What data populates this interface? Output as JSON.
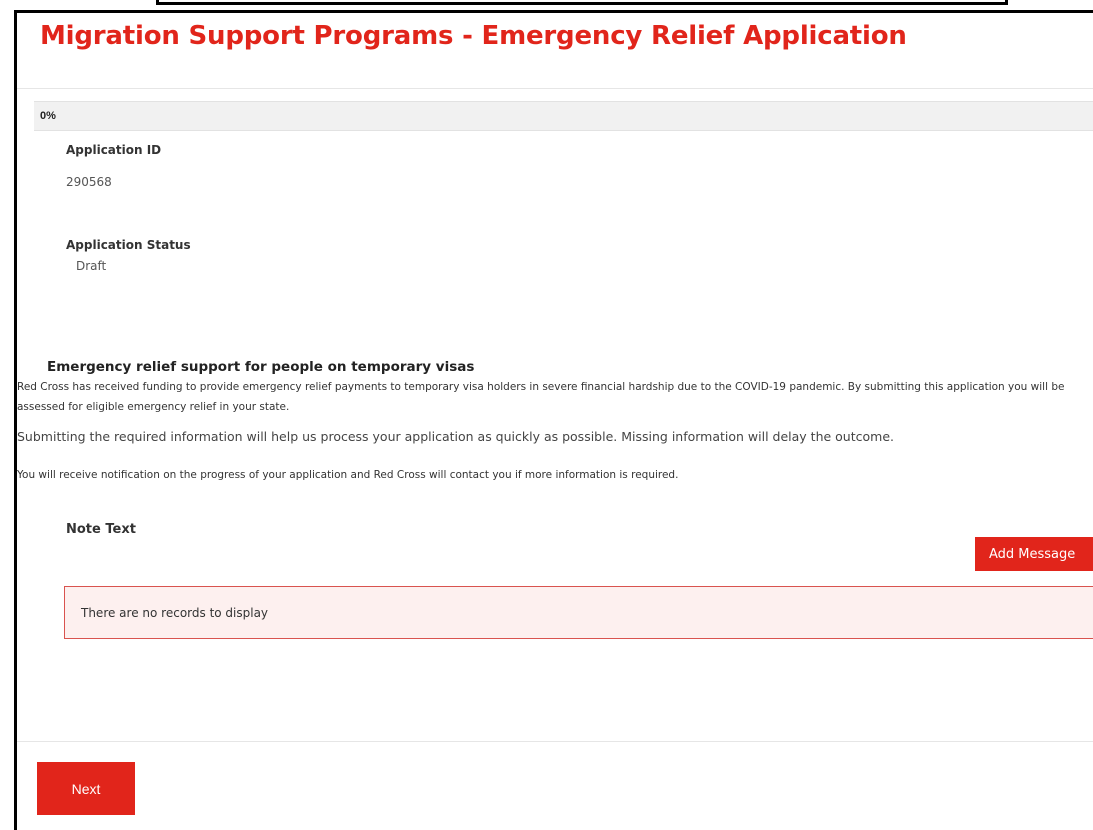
{
  "page": {
    "title": "Migration Support Programs - Emergency Relief Application"
  },
  "progress": {
    "label": "0%",
    "value_percent": 0
  },
  "application": {
    "id_label": "Application ID",
    "id_value": "290568",
    "status_label": "Application Status",
    "status_value": "Draft"
  },
  "section": {
    "heading": "Emergency relief support for people on temporary visas",
    "paragraph_1": "Red Cross has received funding to provide emergency relief payments to temporary visa holders in severe financial hardship due to the COVID-19 pandemic. By submitting this application you will be assessed for eligible emergency relief in your state.",
    "paragraph_2": "Submitting the required information will help us process your application as quickly as possible. Missing information will delay the outcome.",
    "paragraph_3": "You will receive notification on the progress of your application and Red Cross will contact you if more information is required."
  },
  "notes": {
    "label": "Note Text",
    "add_button": "Add Message",
    "empty_message": "There are no records to display"
  },
  "footer": {
    "next_button": "Next"
  },
  "colors": {
    "brand_red": "#e1251b",
    "empty_bg": "#fdf0ef",
    "empty_border": "#d9534f"
  }
}
